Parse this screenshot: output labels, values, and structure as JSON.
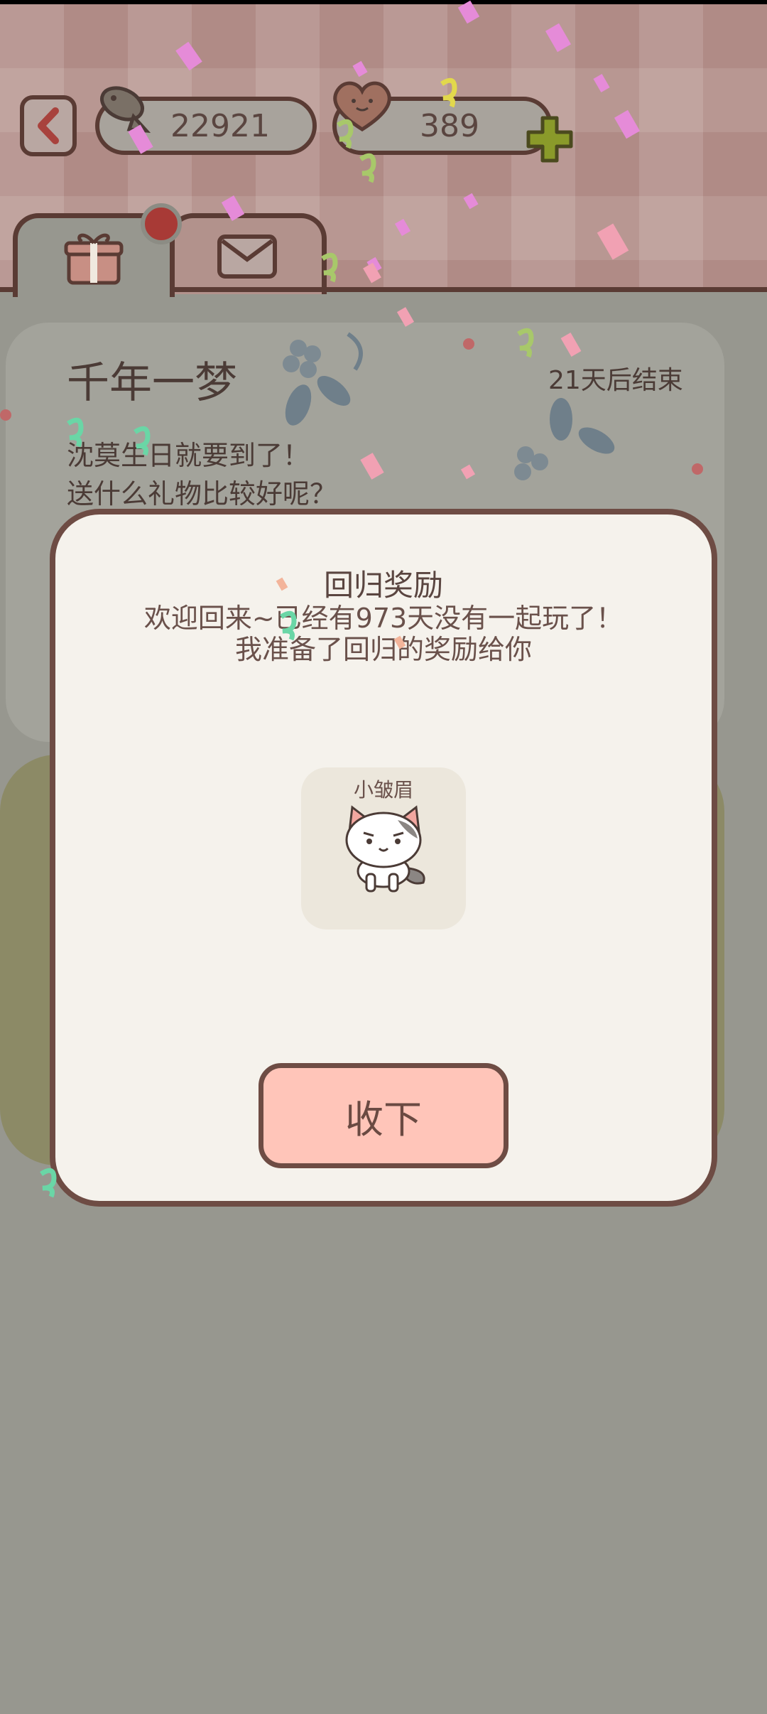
{
  "currency": {
    "fish": "22921",
    "hearts": "389"
  },
  "tabs": [
    {
      "icon": "gift-icon"
    },
    {
      "icon": "mail-icon"
    }
  ],
  "event": {
    "title": "千年一梦",
    "time_left": "21天后结束",
    "desc_line1": "沈莫生日就要到了！",
    "desc_line2": "送什么礼物比较好呢？"
  },
  "modal": {
    "title": "回归奖励",
    "message_line1": "欢迎回来~已经有973天没有一起玩了！",
    "message_line2": "我准备了回归的奖励给你",
    "reward_name": "小皱眉",
    "accept_label": "收下"
  },
  "colors": {
    "accent": "#ffc5b9",
    "outline": "#6e4c44",
    "badge": "#a83a36",
    "plus": "#8a9a2a"
  }
}
